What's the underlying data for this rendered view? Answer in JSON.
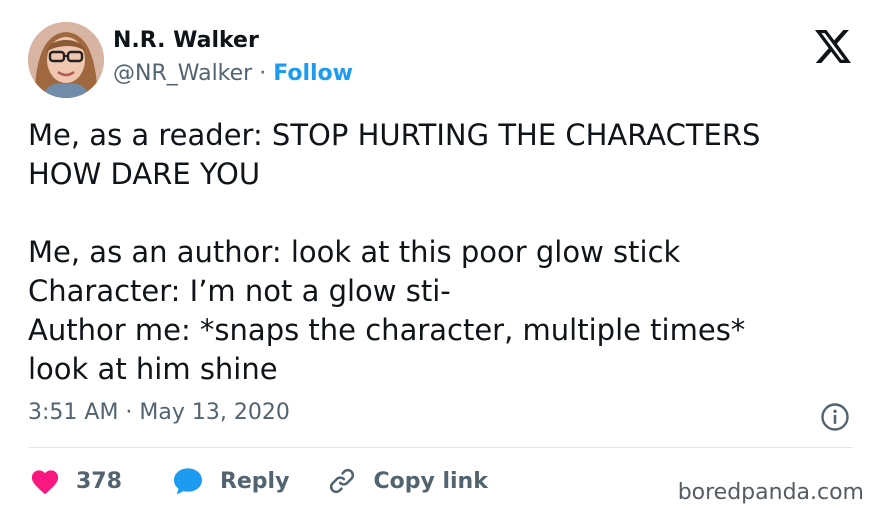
{
  "author": {
    "name": "N.R. Walker",
    "handle": "@NR_Walker",
    "separator": "·",
    "follow_label": "Follow"
  },
  "tweet": {
    "text": "Me, as a reader: STOP HURTING THE CHARACTERS\nHOW DARE YOU\n\nMe, as an author: look at this poor glow stick\nCharacter: I’m not a glow sti-\nAuthor me: *snaps the character, multiple times*\nlook at him shine",
    "timestamp": "3:51 AM · May 13, 2020"
  },
  "actions": {
    "like_count": "378",
    "reply_label": "Reply",
    "copy_label": "Copy link"
  },
  "watermark": "boredpanda.com",
  "colors": {
    "link": "#1d9bf0",
    "heart": "#f91880",
    "reply_bubble": "#1d9bf0",
    "muted": "#536471",
    "text": "#0f1419"
  },
  "icons": [
    "x-logo-icon",
    "info-icon",
    "heart-icon",
    "reply-bubble-icon",
    "link-icon"
  ]
}
